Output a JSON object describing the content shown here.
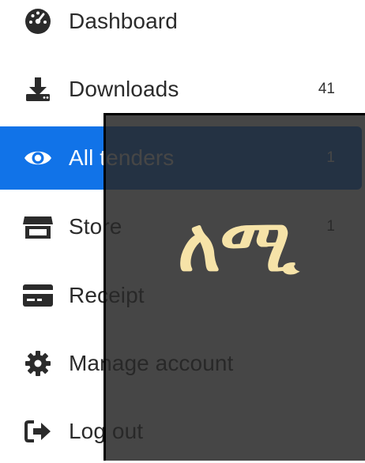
{
  "sidebar": {
    "items": [
      {
        "label": "Dashboard",
        "count": "",
        "icon": "gauge-icon"
      },
      {
        "label": "Downloads",
        "count": "41",
        "icon": "download-icon"
      },
      {
        "label": "All tenders",
        "count": "1",
        "icon": "eye-icon",
        "active": true
      },
      {
        "label": "Store",
        "count": "1",
        "icon": "store-icon"
      },
      {
        "label": "Receipt",
        "count": "",
        "icon": "credit-card-icon"
      },
      {
        "label": "Manage account",
        "count": "",
        "icon": "gear-icon"
      },
      {
        "label": "Log out",
        "count": "",
        "icon": "sign-out-icon"
      }
    ]
  },
  "overlay": {
    "text": "ለሚ"
  },
  "colors": {
    "active_bg": "#1173e8",
    "text": "#2b2b2b",
    "overlay_bg": "#282828",
    "overlay_text": "#f6e3a8"
  }
}
